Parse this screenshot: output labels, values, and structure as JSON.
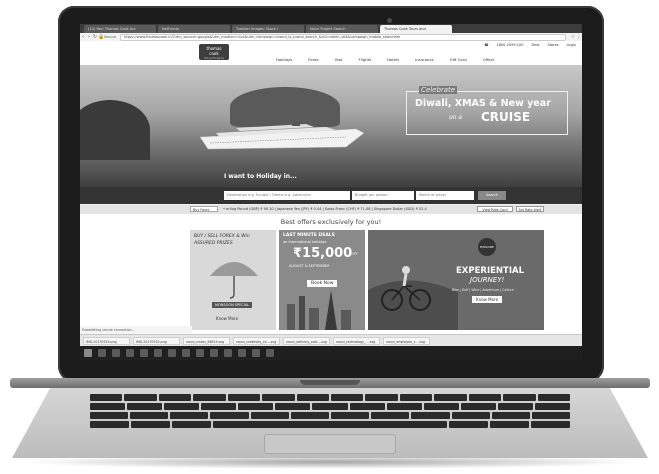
{
  "browser": {
    "tabs": [
      {
        "label": "(14) Your Thomas Cook Acc"
      },
      {
        "label": "NetFunda"
      },
      {
        "label": "Tumbler Images: Stock i"
      },
      {
        "label": "Voice Project Search"
      },
      {
        "label": "Thomas Cook Tours and"
      }
    ],
    "secure_label": "Secure",
    "url": "https://www.thomascook.in/?utm_source=google&utm_medium=cpc&utm_campaign=brand_tc_brand_search_&cid=adnm_sb4&campaign_mobile_searchitm"
  },
  "site": {
    "logo_line1": "thomas",
    "logo_line2": "cook",
    "logo_tagline": "Travel Experts",
    "phone": "1800-2099-100",
    "links": [
      "Deal",
      "Stores",
      "Login"
    ],
    "nav": [
      "Holidays",
      "Forex",
      "Visa",
      "Flights",
      "Hotels",
      "Insurance",
      "Gift Card",
      "Offers"
    ]
  },
  "hero": {
    "promo_line1": "Celebrate",
    "promo_line2": "Diwali, XMAS & New year",
    "promo_line3": "on a",
    "promo_line4": "CRUISE",
    "holiday_label": "I want to Holiday in..."
  },
  "search": {
    "destination_placeholder": "Destination e.g. Europe / Theme e.g. Adventure",
    "budget_placeholder": "Budget per person",
    "month_placeholder": "Month of travel",
    "button_label": "Search"
  },
  "forex": {
    "select_label": "Buy Forex",
    "ticker_text": "• erling Pound (GBP) ₹ 90.10 | Japanese Yen (JPY) ₹ 0.44 | Swiss Franc (CHF) ₹ 71.08 | Singapore Dollar (SGD) ₹ 52.4",
    "view_rate_card": "View Rate Card",
    "set_rate_alert": "Set Rate Alert"
  },
  "offers": {
    "heading": "Best offers exclusively for you!",
    "card1": {
      "line1": "BUY / SELL FOREX & Win",
      "line2": "ASSURED PRIZES",
      "badge": "MONSOON SPECIAL",
      "cta": "Know More"
    },
    "card2": {
      "line1": "LAST MINUTE DEALS",
      "line2": "on International holidays",
      "price": "₹15,000",
      "price_suffix": "OFF",
      "line3": "AUGUST & SEPTEMBER",
      "cta": "Book Now"
    },
    "card3": {
      "badge": "EXPLORE",
      "line1": "EXPERIENTIAL",
      "line2": "JOURNEY!",
      "line3": "Bike | Golf | Wine | Adventure | Culture",
      "cta": "Know More"
    }
  },
  "status_text": "Establishing secure connection...",
  "downloads": [
    "IMG-20170515.png",
    "IMG-20170515.png",
    "nouvi_mixes_94819.svg",
    "nouvi_creativity_ce....svg",
    "nouvi_delivery_cole....svg",
    "nouvi_technology_....svg",
    "nouvi_employee_c....svg"
  ],
  "colors": {
    "bezel": "#1b1b1b",
    "aluminum": "#c8c8c8",
    "hero_dark": "#3f3f3f",
    "taskbar": "#1f1f1f"
  }
}
